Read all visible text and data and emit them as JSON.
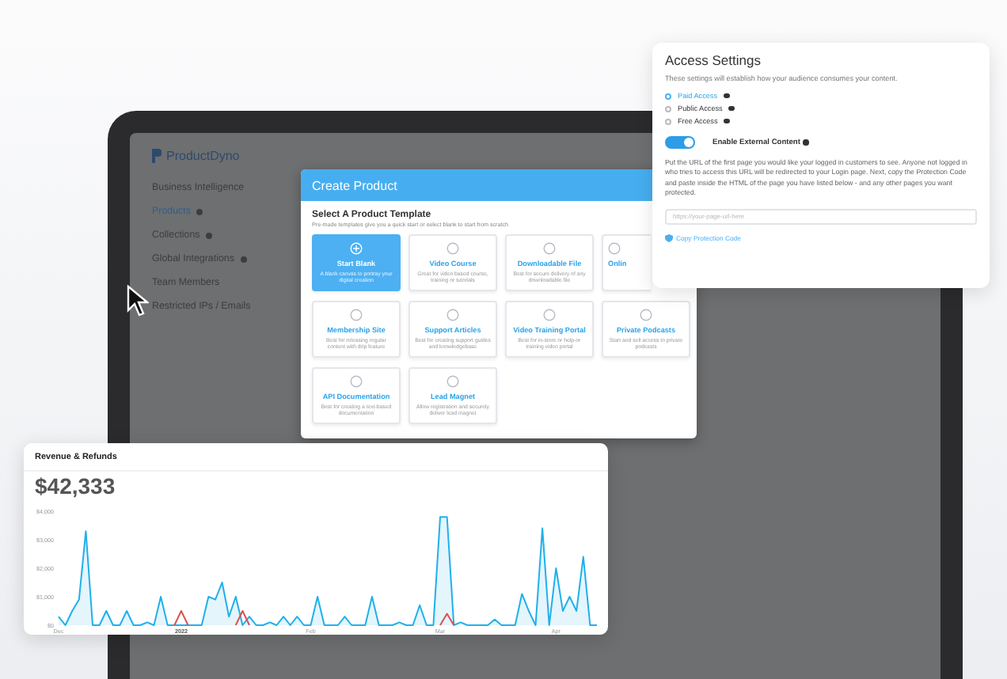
{
  "sidebar": {
    "logo": "ProductDyno",
    "items": [
      {
        "label": "Business Intelligence",
        "selected": false,
        "badge": false
      },
      {
        "label": "Products",
        "selected": true,
        "badge": true
      },
      {
        "label": "Collections",
        "selected": false,
        "badge": true
      },
      {
        "label": "Global Integrations",
        "selected": false,
        "badge": true
      },
      {
        "label": "Team Members",
        "selected": false,
        "badge": false
      },
      {
        "label": "Restricted IPs / Emails",
        "selected": false,
        "badge": false
      }
    ]
  },
  "modal": {
    "title": "Create Product",
    "heading": "Select A Product Template",
    "subheading": "Pre-made templates give you a quick start or select blank to start from scratch",
    "templates": [
      {
        "title": "Start Blank",
        "description": "A blank canvas to portray your digital creation",
        "selected": true,
        "clipped": false
      },
      {
        "title": "Video Course",
        "description": "Great for video based course, training or tutorials",
        "selected": false,
        "clipped": false
      },
      {
        "title": "Downloadable File",
        "description": "Best for secure delivery of any downloadable file",
        "selected": false,
        "clipped": false
      },
      {
        "title": "Onlin",
        "selected": false,
        "clipped": true
      },
      {
        "title": "Membership Site",
        "description": "Best for releasing regular content with drip feature",
        "selected": false,
        "clipped": false
      },
      {
        "title": "Support Articles",
        "description": "Best for creating support guides and knowledgebase",
        "selected": false,
        "clipped": false
      },
      {
        "title": "Video Training Portal",
        "description": "Best for in-store or help-or training video portal",
        "selected": false,
        "clipped": false
      },
      {
        "title": "Private Podcasts",
        "description": "Start and sell access to private podcasts",
        "selected": false,
        "clipped": false
      },
      {
        "title": "API Documentation",
        "description": "Best for creating a text-based documentation",
        "selected": false,
        "clipped": false
      },
      {
        "title": "Lead Magnet",
        "description": "Allow registration and securely deliver lead magnet",
        "selected": false,
        "clipped": false
      }
    ]
  },
  "access": {
    "title": "Access Settings",
    "description": "These settings will establish how your audience consumes your content.",
    "options": [
      {
        "label": "Paid Access",
        "selected": true
      },
      {
        "label": "Public Access",
        "selected": false
      },
      {
        "label": "Free Access",
        "selected": false
      }
    ],
    "toggle": {
      "label": "Enable External Content",
      "on": true
    },
    "instructions": "Put the URL of the first page you would like your logged in customers to see. Anyone not logged in who tries to access this URL will be redirected to your Login page. Next, copy the Protection Code and paste inside the HTML of the page you have listed below - and any other pages you want protected.",
    "url_field": {
      "placeholder": "https://your-page-url-here"
    },
    "link": "Copy Protection Code"
  },
  "revenue": {
    "title": "Revenue & Refunds",
    "total": "$42,333",
    "chart_data": {
      "type": "line",
      "categories": [
        "Dec",
        null,
        null,
        null,
        null,
        null,
        null,
        null,
        null,
        null,
        null,
        null,
        null,
        null,
        null,
        null,
        null,
        null,
        "2022",
        null,
        null,
        null,
        null,
        null,
        null,
        null,
        null,
        null,
        null,
        null,
        null,
        null,
        null,
        null,
        null,
        null,
        null,
        "Feb",
        null,
        null,
        null,
        null,
        null,
        null,
        null,
        null,
        null,
        null,
        null,
        null,
        null,
        null,
        null,
        null,
        null,
        null,
        "Mar",
        null,
        null,
        null,
        null,
        null,
        null,
        null,
        null,
        null,
        null,
        null,
        null,
        null,
        null,
        null,
        null,
        "Apr",
        null,
        null,
        null,
        null,
        null,
        null
      ],
      "series": [
        {
          "color": "#1fb0ea",
          "values": [
            300,
            0,
            500,
            900,
            3300,
            0,
            0,
            500,
            0,
            0,
            500,
            0,
            0,
            100,
            0,
            1000,
            0,
            0,
            0,
            0,
            0,
            0,
            1000,
            900,
            1500,
            300,
            1000,
            0,
            300,
            0,
            0,
            100,
            0,
            300,
            0,
            300,
            0,
            0,
            1000,
            0,
            0,
            0,
            300,
            0,
            0,
            0,
            1000,
            0,
            0,
            0,
            100,
            0,
            0,
            700,
            0,
            0,
            3800,
            3800,
            0,
            100,
            0,
            0,
            0,
            0,
            200,
            0,
            0,
            0,
            1100,
            500,
            0,
            3400,
            0,
            2000,
            500,
            1000,
            500,
            2400,
            0,
            0
          ]
        },
        {
          "color": "#d9534f",
          "values": [
            null,
            null,
            null,
            null,
            null,
            null,
            null,
            null,
            null,
            null,
            null,
            null,
            null,
            null,
            null,
            null,
            null,
            0,
            500,
            0,
            null,
            null,
            null,
            null,
            null,
            null,
            0,
            500,
            0,
            null,
            null,
            null,
            null,
            null,
            null,
            null,
            null,
            null,
            null,
            null,
            null,
            null,
            null,
            null,
            null,
            null,
            null,
            null,
            null,
            null,
            null,
            null,
            null,
            null,
            null,
            null,
            0,
            400,
            0,
            null,
            null,
            null,
            null,
            null,
            null,
            null,
            null,
            null,
            null,
            null,
            null,
            null,
            null,
            null,
            null,
            null,
            null,
            null,
            null,
            null
          ]
        }
      ],
      "ylim": [
        0,
        4000
      ],
      "yticks": [
        {
          "value": 0,
          "label": "$0"
        },
        {
          "value": 1000,
          "label": "$1,000"
        },
        {
          "value": 2000,
          "label": "$2,000"
        },
        {
          "value": 3000,
          "label": "$3,000"
        },
        {
          "value": 4000,
          "label": "$4,000"
        }
      ]
    }
  }
}
